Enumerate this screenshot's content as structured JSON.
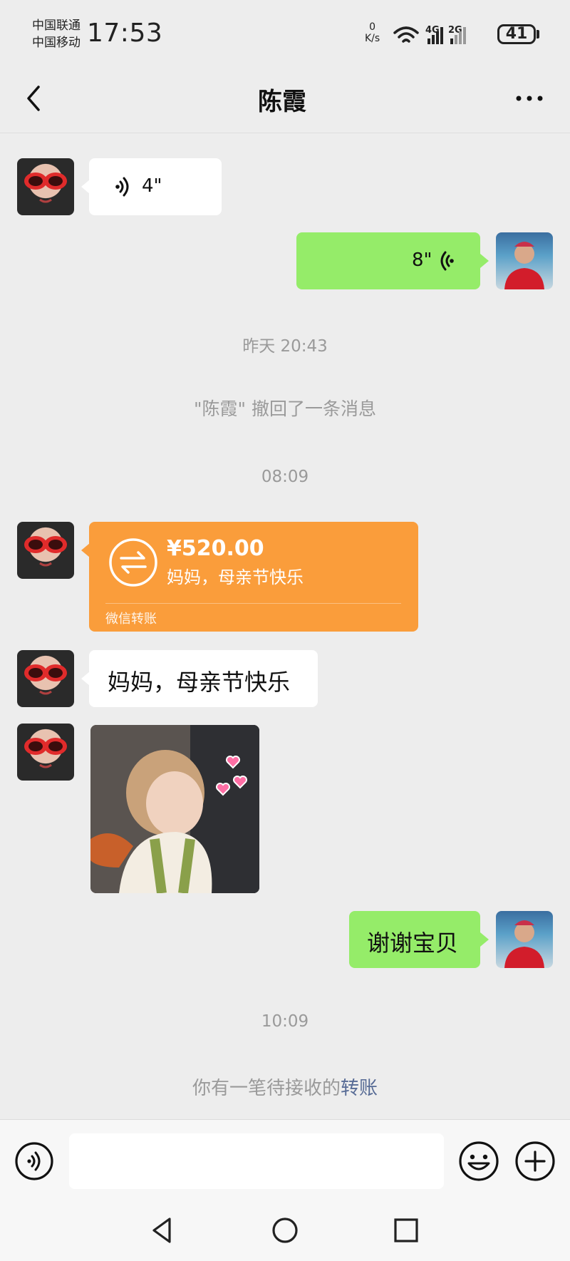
{
  "status_bar": {
    "carrier_1": "中国联通",
    "carrier_2": "中国移动",
    "time": "17:53",
    "net_speed_value": "0",
    "net_speed_unit": "K/s",
    "network_4g": "4G",
    "network_2g": "2G",
    "battery": "41"
  },
  "header": {
    "title": "陈霞",
    "back_icon": "chevron-left-icon",
    "more_icon": "more-dots-icon"
  },
  "messages": [
    {
      "side": "left",
      "type": "voice",
      "duration": "4\""
    },
    {
      "side": "right",
      "type": "voice",
      "duration": "8\""
    },
    {
      "type": "time",
      "text": "昨天 20:43"
    },
    {
      "type": "system",
      "text": "\"陈霞\" 撤回了一条消息"
    },
    {
      "type": "time",
      "text": "08:09"
    },
    {
      "side": "left",
      "type": "transfer",
      "amount": "¥520.00",
      "note": "妈妈，母亲节快乐",
      "label": "微信转账"
    },
    {
      "side": "left",
      "type": "text",
      "text": "妈妈，母亲节快乐"
    },
    {
      "side": "left",
      "type": "image"
    },
    {
      "side": "right",
      "type": "text",
      "text": "谢谢宝贝"
    },
    {
      "type": "time",
      "text": "10:09"
    },
    {
      "type": "system",
      "text_prefix": "你有一笔待接收的",
      "link": "转账"
    }
  ],
  "input_bar": {
    "voice_icon": "voice-toggle-icon",
    "emoji_icon": "emoji-icon",
    "plus_icon": "plus-icon",
    "placeholder": ""
  },
  "system_nav": {
    "back_icon": "triangle-back-icon",
    "home_icon": "circle-home-icon",
    "recents_icon": "square-recents-icon"
  },
  "colors": {
    "background": "#ededed",
    "green_bubble": "#95ec69",
    "transfer_orange": "#fa9d3b",
    "link_blue": "#576b95"
  }
}
